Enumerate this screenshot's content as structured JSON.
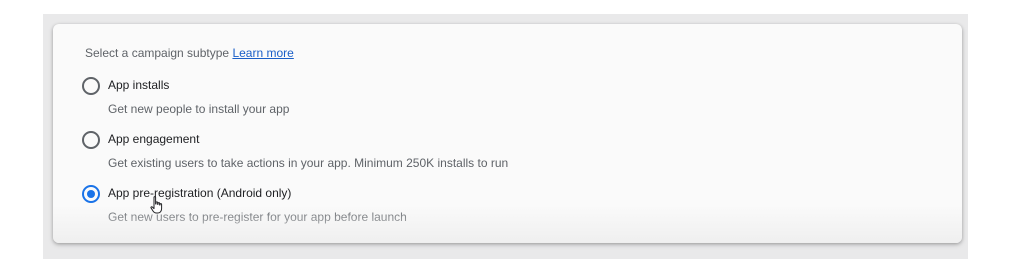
{
  "section": {
    "heading_text": "Select a campaign subtype",
    "learn_more_label": "Learn more"
  },
  "options": [
    {
      "label": "App installs",
      "description": "Get new people to install your app",
      "selected": false
    },
    {
      "label": "App engagement",
      "description": "Get existing users to take actions in your app. Minimum 250K installs to run",
      "selected": false
    },
    {
      "label": "App pre-registration (Android only)",
      "description": "Get new users to pre-register for your app before launch",
      "selected": true
    }
  ],
  "colors": {
    "accent": "#1a73e8",
    "link": "#1a5fc8",
    "text_primary": "#202124",
    "text_secondary": "#5f6368"
  },
  "icons": {
    "cursor": "hand-pointer-icon"
  }
}
